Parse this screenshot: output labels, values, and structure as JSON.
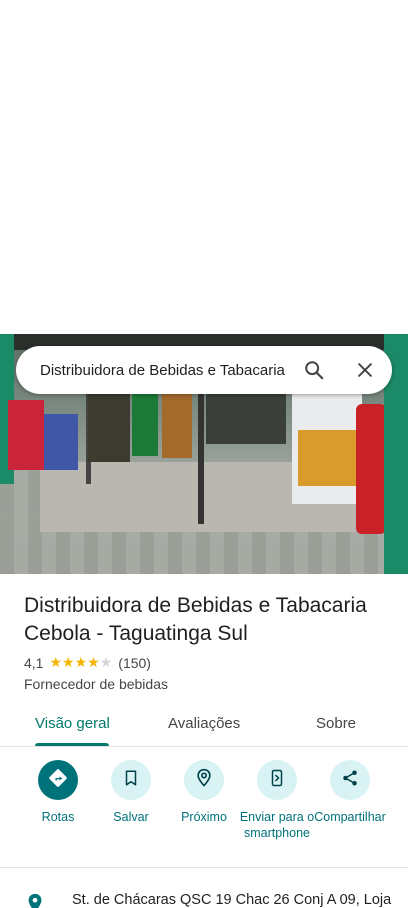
{
  "search": {
    "query": "Distribuidora de Bebidas e Tabacaria Cebola"
  },
  "place": {
    "title": "Distribuidora de Bebidas e Tabacaria Cebola - Taguatinga Sul",
    "rating": "4,1",
    "rating_value": 4.1,
    "reviews_count": "(150)",
    "category": "Fornecedor de bebidas",
    "address": "St. de Chácaras QSC 19 Chac 26 Conj A 09, Loja"
  },
  "tabs": [
    {
      "label": "Visão geral",
      "active": true
    },
    {
      "label": "Avaliações",
      "active": false
    },
    {
      "label": "Sobre",
      "active": false
    }
  ],
  "actions": [
    {
      "label": "Rotas",
      "icon": "directions-icon",
      "primary": true
    },
    {
      "label": "Salvar",
      "icon": "bookmark-icon",
      "primary": false
    },
    {
      "label": "Próximo",
      "icon": "nearby-icon",
      "primary": false
    },
    {
      "label": "Enviar para o smartphone",
      "icon": "send-to-phone-icon",
      "primary": false
    },
    {
      "label": "Compartilhar",
      "icon": "share-icon",
      "primary": false
    }
  ],
  "colors": {
    "accent": "#00796b",
    "action_bg": "#d9f2f4",
    "primary_action": "#00727a",
    "star": "#f4b400"
  }
}
